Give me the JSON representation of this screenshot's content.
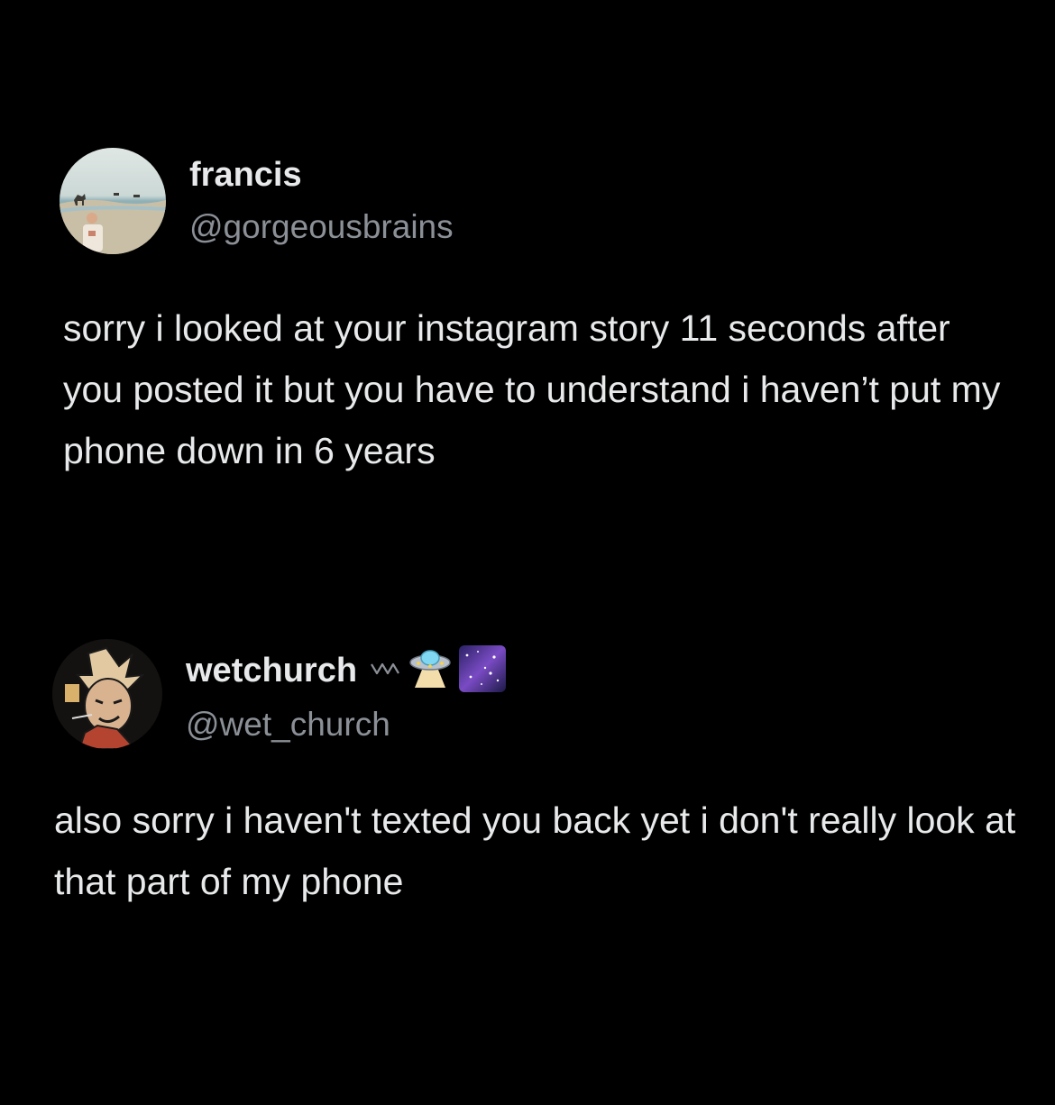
{
  "posts": [
    {
      "display_name": "francis",
      "handle": "@gorgeousbrains",
      "text": "sorry i looked at your instagram story 11 seconds after you posted it but you have to understand i haven’t put my phone down in 6 years",
      "avatar_icon": "beach-photo-avatar"
    },
    {
      "display_name": "wetchurch",
      "handle": "@wet_church",
      "text": "also sorry i haven't texted you back yet i don't really look at that part of my phone",
      "avatar_icon": "cartoon-character-avatar",
      "name_emojis": [
        "wave-icon",
        "ufo-icon",
        "galaxy-icon"
      ]
    }
  ],
  "colors": {
    "background": "#000000",
    "primary_text": "#e7e9ea",
    "secondary_text": "#8b9097"
  }
}
